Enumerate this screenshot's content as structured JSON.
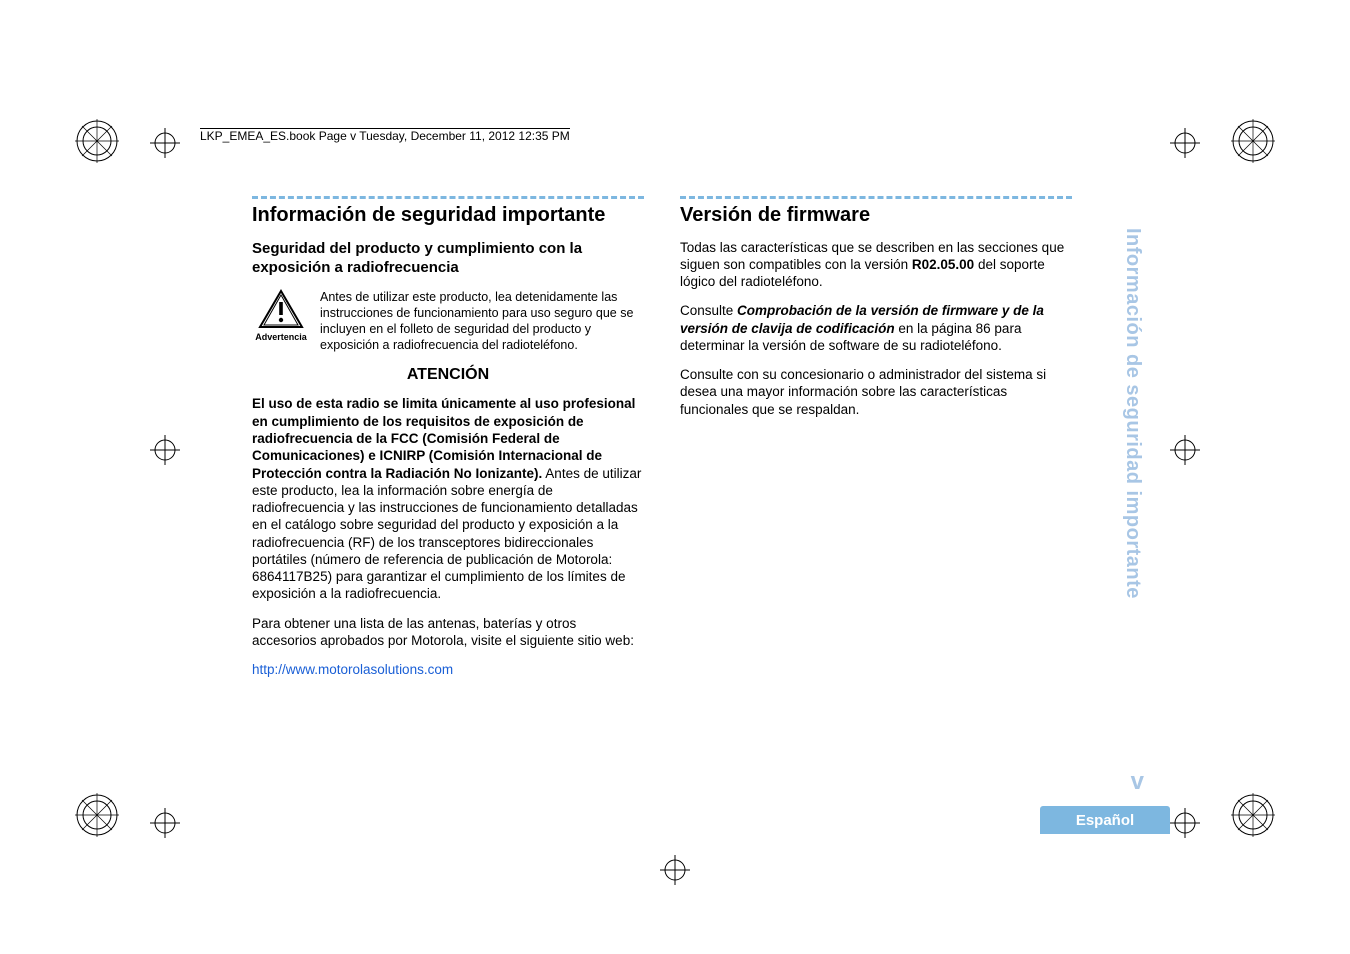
{
  "header": "LKP_EMEA_ES.book  Page v  Tuesday, December 11, 2012  12:35 PM",
  "left": {
    "title": "Información de seguridad importante",
    "subtitle": "Seguridad del producto y cumplimiento con la exposición a radiofrecuencia",
    "warn_label": "Advertencia",
    "warn_text": "Antes de utilizar este producto, lea detenidamente las instrucciones de funcionamiento para uso seguro que se incluyen en el folleto de seguridad del producto y exposición a radiofrecuencia del radioteléfono.",
    "atencion": "ATENCIÓN",
    "para1_bold": "El uso de esta radio se limita únicamente al uso profesional en cumplimiento de los requisitos de exposición de radiofrecuencia de la FCC (Comisión Federal de Comunicaciones) e ICNIRP (Comisión Internacional de Protección contra la Radiación No Ionizante).",
    "para1_rest": " Antes de utilizar este producto, lea la información sobre energía de radiofrecuencia y las instrucciones de funcionamiento detalladas en el catálogo sobre seguridad del producto y exposición a la radiofrecuencia (RF) de los transceptores bidireccionales portátiles (número de referencia de publicación de Motorola: 6864117B25) para garantizar el cumplimiento de los límites de exposición a la radiofrecuencia.",
    "para2": "Para obtener una lista de las antenas, baterías y otros accesorios aprobados por Motorola, visite el siguiente sitio web:",
    "link": "http://www.motorolasolutions.com"
  },
  "right": {
    "title": "Versión de firmware",
    "p1a": "Todas las características que se describen en las secciones que siguen son compatibles con la versión ",
    "p1_bold": "R02.05.00",
    "p1b": " del soporte lógico del radioteléfono.",
    "p2a": "Consulte ",
    "p2_italic": "Comprobación de la versión de firmware y de la versión de clavija de codificación",
    "p2b": " en la página 86 para determinar la versión de software de su radioteléfono.",
    "p3": "Consulte con su concesionario o administrador del sistema si desea una mayor información sobre las características funcionales que se respaldan."
  },
  "side_tab": "Información de seguridad importante",
  "page_num": "v",
  "lang": "Español"
}
